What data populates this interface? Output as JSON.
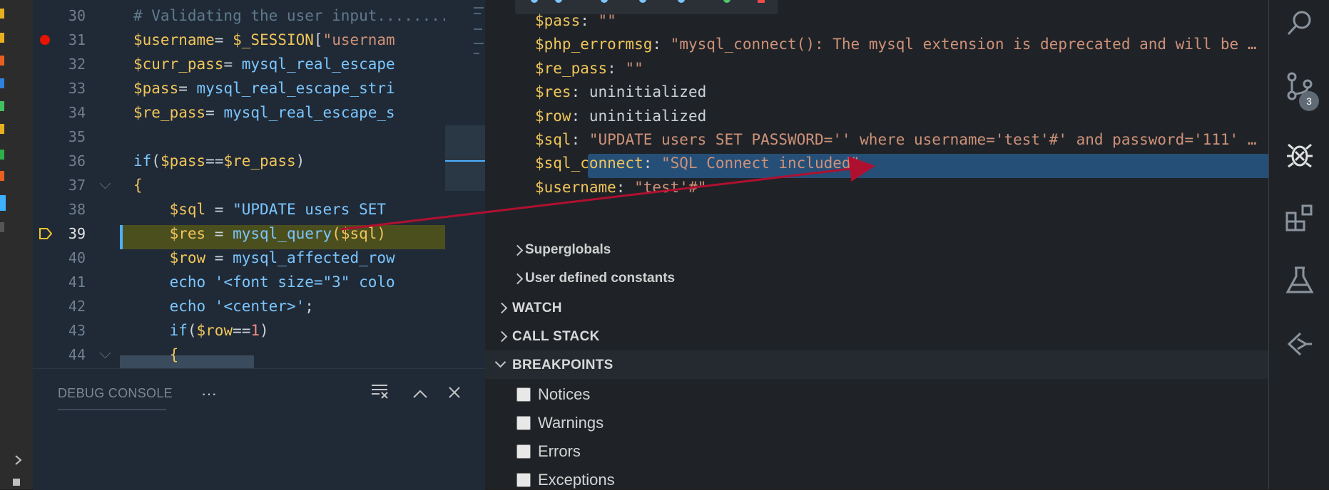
{
  "editor": {
    "lines": [
      {
        "num": "30",
        "tokens": [
          {
            "t": "# Validating the user input........",
            "c": "c"
          }
        ]
      },
      {
        "num": "31",
        "tokens": [
          {
            "t": "$username",
            "c": "v"
          },
          {
            "t": "= ",
            "c": "p"
          },
          {
            "t": "$_SESSION",
            "c": "v"
          },
          {
            "t": "[",
            "c": "p"
          },
          {
            "t": "\"usernam",
            "c": "s"
          }
        ]
      },
      {
        "num": "32",
        "tokens": [
          {
            "t": "$curr_pass",
            "c": "v"
          },
          {
            "t": "= ",
            "c": "p"
          },
          {
            "t": "mysql_real_escape",
            "c": "f"
          }
        ]
      },
      {
        "num": "33",
        "tokens": [
          {
            "t": "$pass",
            "c": "v"
          },
          {
            "t": "= ",
            "c": "p"
          },
          {
            "t": "mysql_real_escape_stri",
            "c": "f"
          }
        ]
      },
      {
        "num": "34",
        "tokens": [
          {
            "t": "$re_pass",
            "c": "v"
          },
          {
            "t": "= ",
            "c": "p"
          },
          {
            "t": "mysql_real_escape_s",
            "c": "f"
          }
        ]
      },
      {
        "num": "35",
        "tokens": []
      },
      {
        "num": "36",
        "tokens": [
          {
            "t": "if",
            "c": "f"
          },
          {
            "t": "(",
            "c": "p"
          },
          {
            "t": "$pass",
            "c": "v"
          },
          {
            "t": "==",
            "c": "p"
          },
          {
            "t": "$re_pass",
            "c": "v"
          },
          {
            "t": ")",
            "c": "p"
          }
        ]
      },
      {
        "num": "37",
        "tokens": [
          {
            "t": "{",
            "c": "v"
          }
        ]
      },
      {
        "num": "38",
        "tokens": [
          {
            "t": "    $sql",
            "c": "v"
          },
          {
            "t": " = ",
            "c": "p"
          },
          {
            "t": "\"UPDATE users SET",
            "c": "f"
          }
        ]
      },
      {
        "num": "39",
        "tokens": [
          {
            "t": "    $res",
            "c": "v"
          },
          {
            "t": " = ",
            "c": "p"
          },
          {
            "t": "mysql_query",
            "c": "f"
          },
          {
            "t": "(",
            "c": "v"
          },
          {
            "t": "$sql",
            "c": "v"
          },
          {
            "t": ")",
            "c": "v"
          }
        ]
      },
      {
        "num": "40",
        "tokens": [
          {
            "t": "    $row",
            "c": "v"
          },
          {
            "t": " = ",
            "c": "p"
          },
          {
            "t": "mysql_affected_row",
            "c": "f"
          }
        ]
      },
      {
        "num": "41",
        "tokens": [
          {
            "t": "    echo ",
            "c": "f"
          },
          {
            "t": "'<font size=\"3\" colo",
            "c": "f"
          }
        ]
      },
      {
        "num": "42",
        "tokens": [
          {
            "t": "    echo ",
            "c": "f"
          },
          {
            "t": "'<center>'",
            "c": "f"
          },
          {
            "t": ";",
            "c": "p"
          }
        ]
      },
      {
        "num": "43",
        "tokens": [
          {
            "t": "    if",
            "c": "f"
          },
          {
            "t": "(",
            "c": "p"
          },
          {
            "t": "$row",
            "c": "v"
          },
          {
            "t": "==",
            "c": "p"
          },
          {
            "t": "1",
            "c": "n"
          },
          {
            "t": ")",
            "c": "p"
          }
        ]
      },
      {
        "num": "44",
        "tokens": [
          {
            "t": "    {",
            "c": "v"
          }
        ]
      }
    ]
  },
  "console": {
    "tab_label": "DEBUG CONSOLE",
    "more_label": "···"
  },
  "variables": [
    {
      "name": "$pass",
      "value": "\"\"",
      "kind": "string"
    },
    {
      "name": "$php_errormsg",
      "value": "\"mysql_connect(): The mysql extension is deprecated and will be …",
      "kind": "string"
    },
    {
      "name": "$re_pass",
      "value": "\"\"",
      "kind": "string"
    },
    {
      "name": "$res",
      "value": "uninitialized",
      "kind": "plain"
    },
    {
      "name": "$row",
      "value": "uninitialized",
      "kind": "plain"
    },
    {
      "name": "$sql",
      "value": "\"UPDATE users SET PASSWORD='' where username='test'#' and password='111' …",
      "kind": "string"
    },
    {
      "name": "$sql_connect",
      "value": "\"SQL Connect included\"",
      "kind": "string"
    },
    {
      "name": "$username",
      "value": "\"test'#\"",
      "kind": "string"
    }
  ],
  "scopes": {
    "superglobals": "Superglobals",
    "user_constants": "User defined constants"
  },
  "sections": {
    "watch": "WATCH",
    "call_stack": "CALL STACK",
    "breakpoints": "BREAKPOINTS"
  },
  "breakpoints": [
    {
      "label": "Notices"
    },
    {
      "label": "Warnings"
    },
    {
      "label": "Errors"
    },
    {
      "label": "Exceptions"
    }
  ],
  "activity": {
    "scm_badge": "3"
  },
  "colors": {
    "breakpoint": "#e51400",
    "current_line": "#4b4f1e",
    "selection": "#264f78",
    "annotation_arrow": "#b01030"
  }
}
